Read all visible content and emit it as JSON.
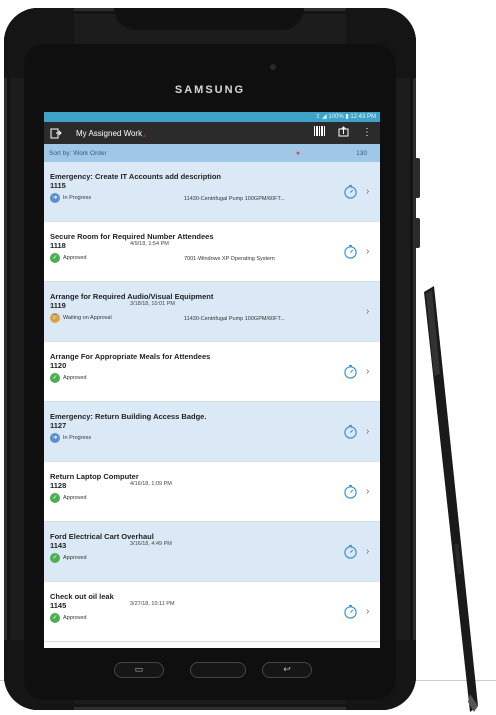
{
  "device": {
    "brand": "SAMSUNG"
  },
  "statusbar": {
    "text": "⇪ ◢ 100% ▮ 12:43 PM"
  },
  "appbar": {
    "title": "My Assigned Work"
  },
  "sortbar": {
    "label": "Sort by: Work Order",
    "count": "130"
  },
  "work_orders": [
    {
      "name": "Emergency: Create IT Accounts add description",
      "number": "1115",
      "date": "",
      "status": "In Progress",
      "asset": "11430-Centrifugal Pump 100GPM/60FT...",
      "has_timer": true
    },
    {
      "name": "Secure Room for Required Number Attendees",
      "number": "1118",
      "date": "4/9/18, 1:54 PM",
      "status": "Approved",
      "asset": "7001-Windows XP Operating System",
      "has_timer": true
    },
    {
      "name": "Arrange for Required Audio/Visual Equipment",
      "number": "1119",
      "date": "3/18/18, 10:01 PM",
      "status": "Waiting on Approval",
      "asset": "11430-Centrifugal Pump 100GPM/60FT...",
      "has_timer": false
    },
    {
      "name": "Arrange For Appropriate Meals for Attendees",
      "number": "1120",
      "date": "",
      "status": "Approved",
      "asset": "",
      "has_timer": true
    },
    {
      "name": "Emergency: Return Building Access Badge.",
      "number": "1127",
      "date": "",
      "status": "In Progress",
      "asset": "",
      "has_timer": true
    },
    {
      "name": "Return Laptop Computer",
      "number": "1128",
      "date": "4/16/18, 1:09 PM",
      "status": "Approved",
      "asset": "",
      "has_timer": true
    },
    {
      "name": "Ford Electrical Cart Overhaul",
      "number": "1143",
      "date": "3/16/18, 4:49 PM",
      "status": "Approved",
      "asset": "",
      "has_timer": true
    },
    {
      "name": "Check out oil leak",
      "number": "1145",
      "date": "3/27/18, 10:11 PM",
      "status": "Approved",
      "asset": "",
      "has_timer": true
    }
  ],
  "icons": {
    "app": "clipboard-icon",
    "toolbar": [
      "barcode-icon",
      "upload-icon",
      "more-vertical-icon"
    ],
    "status": {
      "In Progress": "arrow-right-icon",
      "Approved": "check-circle-icon",
      "Waiting on Approval": "hourglass-icon"
    }
  },
  "colors": {
    "statusbar": "#3da3c7",
    "appbar": "#2b2b2b",
    "sortbar": "#9fc7e8",
    "row_alt": "#dbe9f7",
    "approved": "#4caf50",
    "in_progress": "#5b8fc7",
    "waiting": "#e0a43a",
    "timer": "#3b8fd1"
  }
}
